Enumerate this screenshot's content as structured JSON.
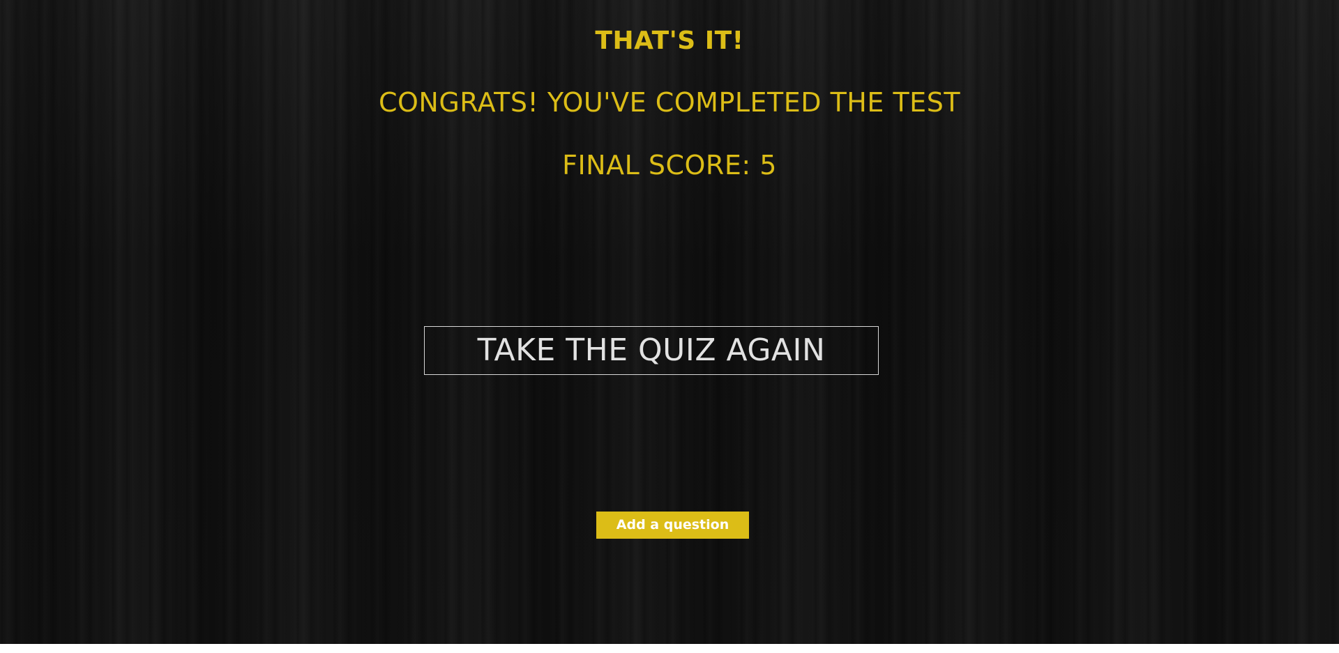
{
  "result": {
    "headline": "THAT'S IT!",
    "congrats": "CONGRATS! YOU'VE COMPLETED THE TEST",
    "score_label": "FINAL SCORE: 5"
  },
  "actions": {
    "retry_label": "TAKE THE QUIZ AGAIN",
    "add_question_label": "Add a question"
  },
  "colors": {
    "accent": "#dcbd17",
    "background": "#151515",
    "button_border": "#d8d8d8",
    "button_text": "#e2e2e2"
  }
}
